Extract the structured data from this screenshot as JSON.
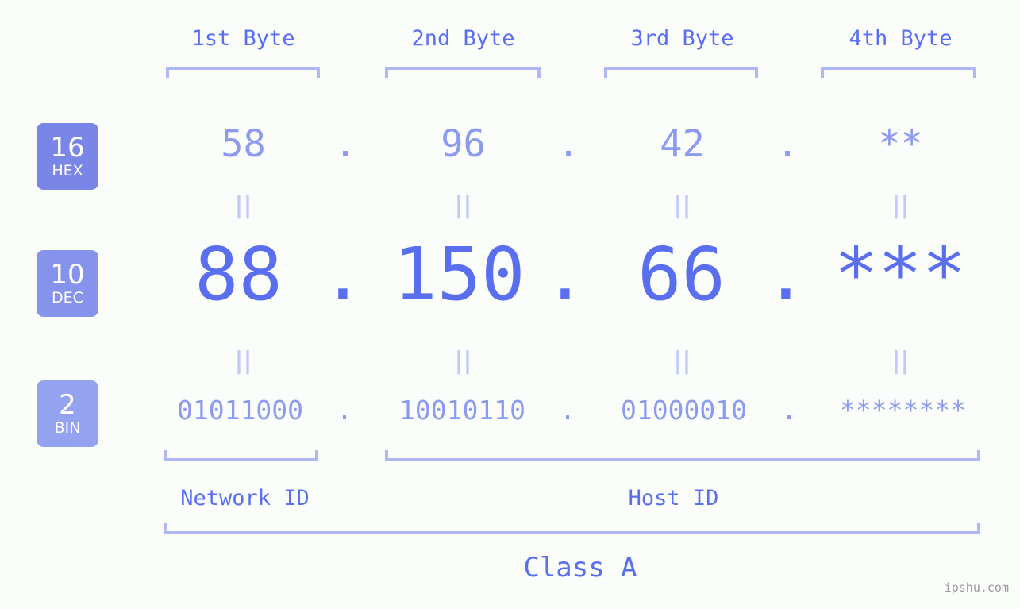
{
  "meta": {
    "background_color": "#fbfdfa",
    "accent_color": "#5a6ef0",
    "accent_light_color": "#8c9af0",
    "bracket_color": "#aeb8f7",
    "connector_color": "#c2cbf8",
    "watermark": "ipshu.com"
  },
  "headers": [
    {
      "label": "1st Byte"
    },
    {
      "label": "2nd Byte"
    },
    {
      "label": "3rd Byte"
    },
    {
      "label": "4th Byte"
    }
  ],
  "rows": [
    {
      "base": "16",
      "abbr": "HEX",
      "badge_color": "#7986e8",
      "values": [
        "58",
        "96",
        "42",
        "**"
      ],
      "separators": [
        ".",
        ".",
        "."
      ]
    },
    {
      "base": "10",
      "abbr": "DEC",
      "badge_color": "#8693ec",
      "values": [
        "88",
        "150",
        "66",
        "***"
      ],
      "separators": [
        ".",
        ".",
        "."
      ]
    },
    {
      "base": "2",
      "abbr": "BIN",
      "badge_color": "#93a3f0",
      "values": [
        "01011000",
        "10010110",
        "01000010",
        "********"
      ],
      "separators": [
        ".",
        ".",
        "."
      ]
    }
  ],
  "connectors": {
    "glyph": "||"
  },
  "segments": {
    "network_id": "Network ID",
    "host_id": "Host ID",
    "class": "Class A"
  }
}
